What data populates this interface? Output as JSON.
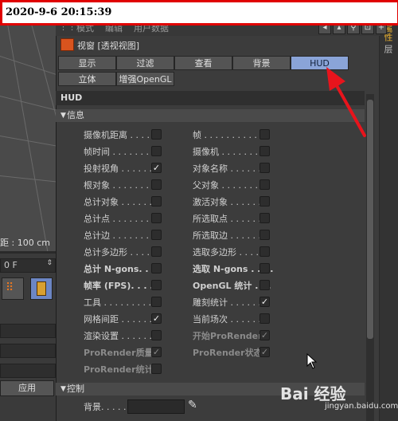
{
  "timestamp": "2020-9-6 20:15:39",
  "topbar": {
    "items": [
      "模式",
      "编辑",
      "用户数据"
    ]
  },
  "background_app": {
    "viewport_readout": "距 : 100 cm",
    "frame_field": "0 F",
    "apply_label": "应用",
    "right_tabs": [
      "属性",
      "层"
    ]
  },
  "dialog": {
    "title": "视窗 [透视视图]",
    "tabs_row1": [
      {
        "label": "显示",
        "active": false
      },
      {
        "label": "过滤",
        "active": false
      },
      {
        "label": "查看",
        "active": false
      },
      {
        "label": "背景",
        "active": false
      },
      {
        "label": "HUD",
        "active": true
      }
    ],
    "tabs_row2": [
      {
        "label": "立体",
        "active": false
      },
      {
        "label": "增强OpenGL",
        "active": false
      }
    ],
    "section_title": "HUD",
    "info_group": "信息",
    "control_group": "控制",
    "left_column": [
      {
        "label": "摄像机距离 . . . .",
        "checked": false,
        "dim": false
      },
      {
        "label": "帧时间 . . . . . . . .",
        "checked": false,
        "dim": false
      },
      {
        "label": "投射视角 . . . . . .",
        "checked": true,
        "dim": false
      },
      {
        "label": "根对象 . . . . . . . .",
        "checked": false,
        "dim": false
      },
      {
        "label": "总计对象 . . . . . .",
        "checked": false,
        "dim": false
      },
      {
        "label": "总计点 . . . . . . . .",
        "checked": false,
        "dim": false
      },
      {
        "label": "总计边 . . . . . . . .",
        "checked": false,
        "dim": false
      },
      {
        "label": "总计多边形 . . . .",
        "checked": false,
        "dim": false
      },
      {
        "label": "总计 N-gons. . . .",
        "checked": false,
        "dim": false
      },
      {
        "label": "帧率 (FPS). . . . .",
        "checked": false,
        "dim": false
      },
      {
        "label": "工具 . . . . . . . . . .",
        "checked": false,
        "dim": false
      },
      {
        "label": "网格间距 . . . . . .",
        "checked": true,
        "dim": false
      },
      {
        "label": "渲染设置 . . . . . .",
        "checked": false,
        "dim": false
      },
      {
        "label": "ProRender质量",
        "checked": true,
        "dim": true
      },
      {
        "label": "ProRender统计",
        "checked": false,
        "dim": true
      }
    ],
    "right_column": [
      {
        "label": "帧 . . . . . . . . . . . .",
        "checked": false,
        "dim": false
      },
      {
        "label": "摄像机 . . . . . . . .",
        "checked": false,
        "dim": false
      },
      {
        "label": "对象名称 . . . . . .",
        "checked": false,
        "dim": false
      },
      {
        "label": "父对象 . . . . . . . .",
        "checked": false,
        "dim": false
      },
      {
        "label": "激活对象 . . . . . .",
        "checked": false,
        "dim": false
      },
      {
        "label": "所选取点 . . . . . .",
        "checked": false,
        "dim": false
      },
      {
        "label": "所选取边 . . . . . .",
        "checked": false,
        "dim": false
      },
      {
        "label": "选取多边形 . . . .",
        "checked": false,
        "dim": false
      },
      {
        "label": "选取 N-gons . . . .",
        "checked": false,
        "dim": false
      },
      {
        "label": "OpenGL 统计 . . .",
        "checked": false,
        "dim": false
      },
      {
        "label": "雕刻统计 . . . . . .",
        "checked": true,
        "dim": false
      },
      {
        "label": "当前场次 . . . . . .",
        "checked": false,
        "dim": false
      },
      {
        "label": "开始ProRender",
        "checked": true,
        "dim": true
      },
      {
        "label": "ProRender状态",
        "checked": true,
        "dim": true
      }
    ],
    "background_label": "背景. . . . ."
  },
  "watermark": {
    "text": "Bai 经验",
    "url": "jingyan.baidu.com"
  },
  "colors": {
    "active_tab": "#8aa4d8",
    "annotation_arrow": "#e8141c",
    "timestamp_border": "#e00000"
  }
}
